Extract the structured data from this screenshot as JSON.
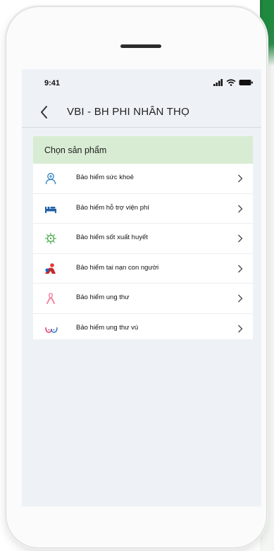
{
  "status_bar": {
    "time": "9:41"
  },
  "header": {
    "title": "VBI - BH PHI NHÂN THỌ"
  },
  "section": {
    "title": "Chọn sản phẩm"
  },
  "products": [
    {
      "label": "Bảo hiểm sức khoẻ",
      "icon": "health-icon"
    },
    {
      "label": "Bảo hiểm hỗ trợ viện phí",
      "icon": "hospital-bed-icon"
    },
    {
      "label": "Bảo hiểm sốt xuất huyết",
      "icon": "virus-icon"
    },
    {
      "label": "Bảo hiểm tai nạn con người",
      "icon": "accident-icon"
    },
    {
      "label": "Bảo hiểm ung thư",
      "icon": "cancer-ribbon-icon"
    },
    {
      "label": "Bảo hiểm ung thư vú",
      "icon": "breast-cancer-icon"
    }
  ],
  "colors": {
    "accent_green": "#1f8a3e",
    "section_bg": "#d8ecd3",
    "screen_bg": "#eef2f6"
  }
}
